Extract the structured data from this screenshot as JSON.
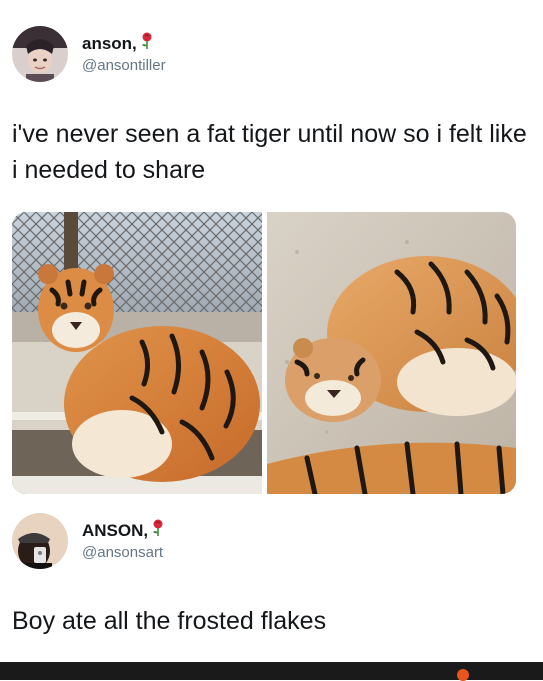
{
  "tweet1": {
    "display_name": "anson,",
    "handle": "@ansontiller",
    "text": "i've never seen a fat tiger until now so i felt like i needed to share",
    "emoji_icon": "rose-icon",
    "images": [
      "tiger-sitting-photo",
      "tiger-lying-photo"
    ]
  },
  "tweet2": {
    "display_name": "ANSON,",
    "handle": "@ansonsart",
    "text": "Boy ate all the frosted flakes",
    "emoji_icon": "rose-icon"
  },
  "colors": {
    "text": "#14171a",
    "handle": "#657786",
    "bottom_bar": "#1a1a1a",
    "accent_dot": "#e8541a"
  }
}
